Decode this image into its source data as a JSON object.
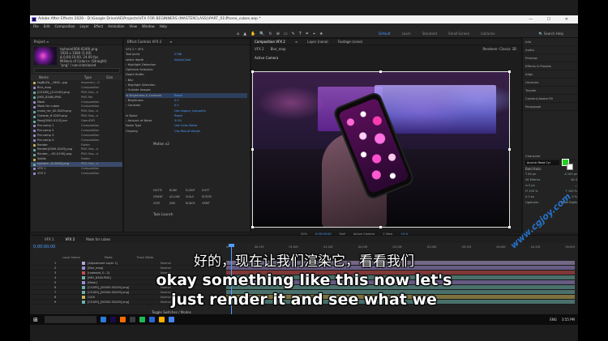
{
  "window": {
    "title": "Adobe After Effects 2020 - D:\\Google Drive\\AE\\Projects\\VFX FOR BEGINNERS (MASTERCLASS)\\PART_01\\Phone_cubes.aep *",
    "controls": "— ☐ ✕"
  },
  "menu": [
    "File",
    "Edit",
    "Composition",
    "Layer",
    "Effect",
    "Animation",
    "View",
    "Window",
    "Help"
  ],
  "toolbar": {
    "tools": [
      "⌂",
      "▲",
      "✋",
      "🔍",
      "↻",
      "⊕",
      "▭",
      "✎",
      "T",
      "✒",
      "⌖",
      "★"
    ],
    "workspaces": [
      "Default",
      "Learn",
      "Standard",
      "Small Screen",
      "Libraries"
    ],
    "active_workspace": "Default",
    "search_help": "Search Help"
  },
  "project": {
    "tab": "Project ≡",
    "thumb_info": [
      "hphone(000-0249).png",
      "1920 x 1080 (1.00)",
      "Δ 0;00;10;00, 24.00 fps",
      "Millions of Colors+ (Straight)",
      "\"png\" / non-interlaced"
    ],
    "headers": [
      "Name",
      "Type",
      "Size"
    ],
    "rows": [
      {
        "name": "fxgBuZd__1862...jpg",
        "type": "ImporterJ...G",
        "size": "",
        "color": "#c8b45a"
      },
      {
        "name": "Blur_map",
        "type": "Composition",
        "size": "",
        "color": "#9c8bd3"
      },
      {
        "name": "[C0185]_[0-0249].png",
        "type": "PNG Seq...e",
        "size": "",
        "color": "#6cb0a8"
      },
      {
        "name": "[IMG_8346].PNG",
        "type": "PNG file",
        "size": "",
        "color": "#6cb0a8"
      },
      {
        "name": "Mask",
        "type": "Composition",
        "size": "",
        "color": "#9c8bd3"
      },
      {
        "name": "Mask for cubes",
        "type": "Composition",
        "size": "",
        "color": "#9c8bd3"
      },
      {
        "name": "mask_rec_00-0249.png",
        "type": "PNG Seq...e",
        "size": "",
        "color": "#6cb0a8"
      },
      {
        "name": "Outside_H-0249.png",
        "type": "PNG Seq...e",
        "size": "",
        "color": "#6cb0a8"
      },
      {
        "name": "Pass[0000-0115].exr",
        "type": "OpenEXR",
        "size": "",
        "color": "#6cb0a8"
      },
      {
        "name": "Pre-comp 1",
        "type": "Composition",
        "size": "",
        "color": "#9c8bd3"
      },
      {
        "name": "Pre-comp 2",
        "type": "Composition",
        "size": "",
        "color": "#9c8bd3"
      },
      {
        "name": "Pre-comp 3",
        "type": "Composition",
        "size": "",
        "color": "#9c8bd3"
      },
      {
        "name": "Pre-comp 4",
        "type": "Composition",
        "size": "",
        "color": "#9c8bd3"
      },
      {
        "name": "Render",
        "type": "Folder",
        "size": "",
        "color": "#c8b45a"
      },
      {
        "name": "Render[0000-0249].png",
        "type": "PNG Seq...e",
        "size": "",
        "color": "#6cb0a8"
      },
      {
        "name": "Render_...00-0190].png",
        "type": "PNG Seq...e",
        "size": "",
        "color": "#6cb0a8"
      },
      {
        "name": "Solids",
        "type": "Folder",
        "size": "",
        "color": "#c8b45a"
      },
      {
        "name": "hphone...0-0249].png",
        "type": "PNG Seq...e",
        "size": "",
        "color": "#6cb0a8",
        "selected": true
      },
      {
        "name": "VFX 1",
        "type": "Composition",
        "size": "",
        "color": "#9c8bd3"
      },
      {
        "name": "VFX 2",
        "type": "Composition",
        "size": "",
        "color": "#9c8bd3"
      }
    ]
  },
  "effects": {
    "tabs": [
      "Effect Controls VFX 2",
      "≡"
    ],
    "header": "VFX 2 • VFX",
    "rows": [
      {
        "label": "Tool point",
        "value": "2788"
      },
      {
        "label": "select depth",
        "value": "Alpha/Color"
      },
      {
        "label": "› Highlight Detection",
        "value": ""
      },
      {
        "label": "Optimize Selection",
        "value": ""
      },
      {
        "label": "Depth Buffer",
        "value": ""
      },
      {
        "label": "› Blur",
        "value": ""
      },
      {
        "label": "› Highlight Selection",
        "value": ""
      },
      {
        "label": "› Outside Images",
        "value": ""
      },
      {
        "label": "fx Brightness & Contrast",
        "value": "Reset",
        "hl": true
      },
      {
        "label": "› Brightness",
        "value": "0.0"
      },
      {
        "label": "› Contrast",
        "value": "0.0"
      },
      {
        "label": "",
        "value": "Use Legacy (supports"
      },
      {
        "label": "fx Noise",
        "value": "Reset"
      },
      {
        "label": "› Amount of Noise",
        "value": "3.0%"
      },
      {
        "label": "Noise Type",
        "value": "Use Color Noise"
      },
      {
        "label": "Clipping",
        "value": "Clip Result Values"
      }
    ],
    "motion_label": "Motion v2",
    "motion_buttons": [
      "EXCITE",
      "BLINK",
      "ELIGNT",
      "ELEFT",
      "ORIENT",
      "ACLONE",
      "SCALE",
      "ROTATE",
      "SORT",
      "JERK",
      "NUDGE",
      "ORBIT"
    ],
    "task_launch": "Task Launch"
  },
  "composition": {
    "tabs": [
      "Composition VFX 2",
      "≡",
      "Layer (none)",
      "Footage (none)"
    ],
    "subtabs": [
      "VFX 2",
      "Blur_map"
    ],
    "renderer": "Renderer: Classic 3D",
    "camera_label": "Active Camera",
    "viewer_bar": [
      "50%",
      "0;00;00;00",
      "Half",
      "Active Camera",
      "1 View",
      "+0.0"
    ]
  },
  "rightcol": {
    "sections": [
      "Info",
      "Audio",
      "Preview",
      "Effects & Presets",
      "Align",
      "Libraries",
      "Tracker",
      "Content-Aware Fill",
      "Paragraph"
    ],
    "character": {
      "title": "Character",
      "font": "Acumin Read Cyr",
      "style": "Bold Italic",
      "rows": [
        [
          "T 64 px",
          "A 105 px"
        ],
        [
          "VA Metrics",
          "VA 0"
        ],
        [
          "≡ 0 px",
          "—"
        ],
        [
          "IT 100 %",
          "T 100 %"
        ],
        [
          "A 0 px",
          "0 %"
        ]
      ],
      "checks": [
        "Ligatures",
        "Hindi Digits"
      ]
    }
  },
  "timeline": {
    "tabs": [
      "VFX 1",
      "VFX 2",
      "Mask for cubes"
    ],
    "active_tab": "VFX 2",
    "timecode": "0;00;00;00",
    "headers": [
      "Layer Name",
      "Mode",
      "Track Matte"
    ],
    "layers": [
      {
        "num": "1",
        "name": "[Adjustment Layer 1]",
        "mode": "Normal",
        "color": "#b7a3d8"
      },
      {
        "num": "2",
        "name": "[Blur_map]",
        "mode": "Normal",
        "color": "#9c8bd3"
      },
      {
        "num": "3",
        "name": "[noteadd_O...2]",
        "mode": "Normal",
        "color": "#cc4b4b"
      },
      {
        "num": "4",
        "name": "[IMG_8346.PNG]",
        "mode": "Add",
        "color": "#6cb0a8"
      },
      {
        "num": "5",
        "name": "[Mask]",
        "mode": "Normal",
        "color": "#9c8bd3"
      },
      {
        "num": "6",
        "name": "[C0185]_[00000-00249].png]",
        "mode": "Normal",
        "color": "#6cb0a8"
      },
      {
        "num": "7",
        "name": "[C0185]_[00000-00249].png]",
        "mode": "Normal",
        "color": "#6cb0a8"
      },
      {
        "num": "8",
        "name": "CLEX",
        "mode": "Normal",
        "color": "#c8b45a"
      },
      {
        "num": "9",
        "name": "[C0185]_[00000-00249].png]",
        "mode": "Normal",
        "color": "#6cb0a8"
      }
    ],
    "ruler": [
      "0f",
      "00:15f",
      "01:00f",
      "01:15f",
      "02:00f",
      "02:15f",
      "03:00f",
      "03:15f",
      "04:00f",
      "04:15f",
      "05:00f"
    ],
    "toggle": "Toggle Switches / Modes"
  },
  "subtitles": {
    "cn": "好的，现在让我们渲染它，看看我们",
    "en1": "okay something like this now let's",
    "en2": "just render it and see what we"
  },
  "watermark": "www.cgjoy.com",
  "taskbar": {
    "lang": "ENG",
    "time": "3:55 PM",
    "icons": [
      "#2b7bdc",
      "#1a0a4a",
      "#ff6b00",
      "#3b3b3b",
      "#1db954",
      "#2a66d6",
      "#ffb000",
      "#4285f4"
    ]
  }
}
